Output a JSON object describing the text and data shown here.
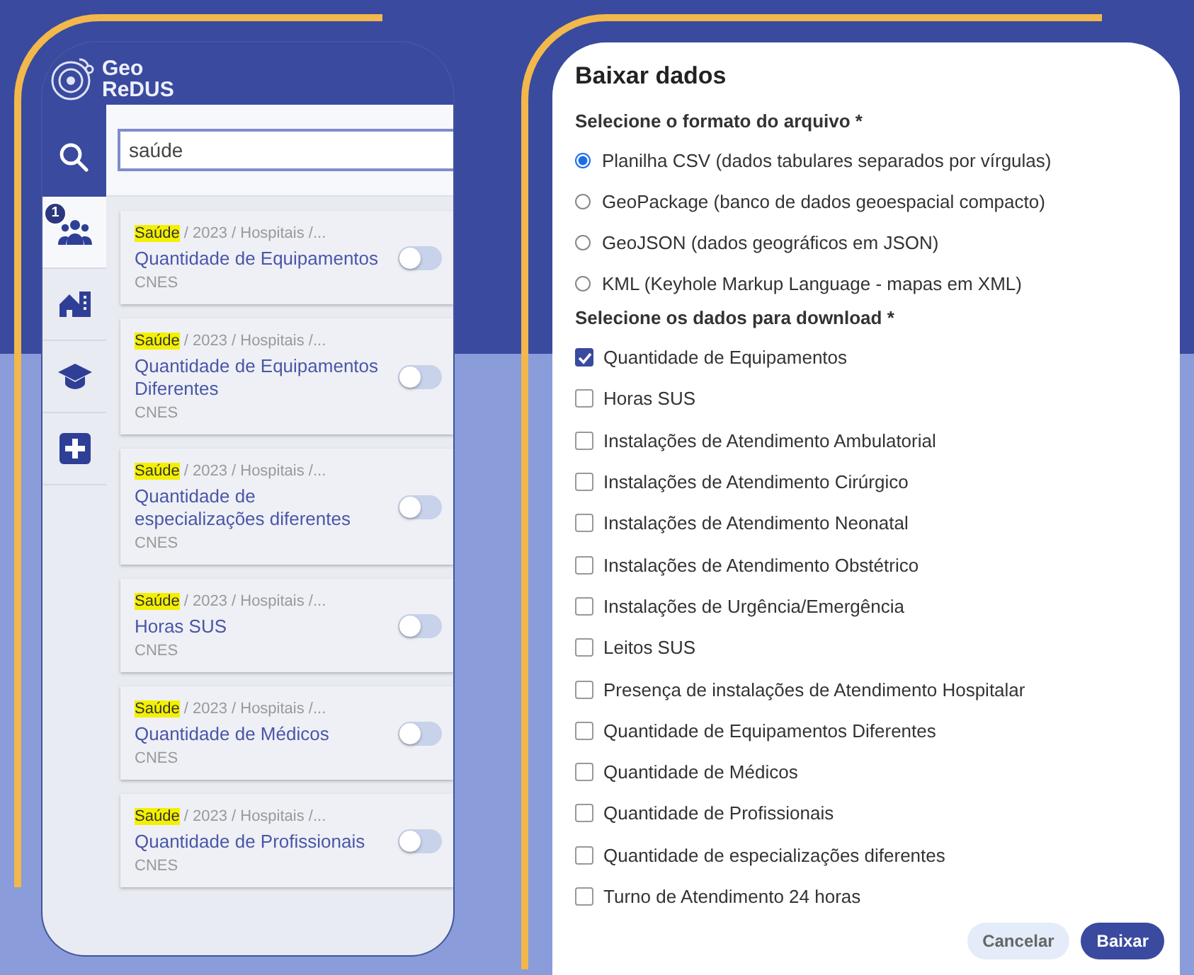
{
  "app": {
    "logo_line_1": "Geo",
    "logo_line_2": "ReDUS"
  },
  "sidebar": {
    "tabs": [
      {
        "kind": "search",
        "selected": false
      },
      {
        "kind": "people",
        "selected": true,
        "badge": "1"
      },
      {
        "kind": "building",
        "selected": false
      },
      {
        "kind": "education",
        "selected": false
      },
      {
        "kind": "health",
        "selected": false
      }
    ]
  },
  "search": {
    "value": "saúde"
  },
  "results": [
    {
      "highlight": "Saúde",
      "path": " / 2023 / Hospitais /...",
      "title": "Quantidade de Equipamentos",
      "source": "CNES",
      "on": false
    },
    {
      "highlight": "Saúde",
      "path": " / 2023 / Hospitais /...",
      "title": "Quantidade de Equipamentos Diferentes",
      "source": "CNES",
      "on": false
    },
    {
      "highlight": "Saúde",
      "path": " / 2023 / Hospitais /...",
      "title": "Quantidade de especializações diferentes",
      "source": "CNES",
      "on": false
    },
    {
      "highlight": "Saúde",
      "path": " / 2023 / Hospitais /...",
      "title": "Horas SUS",
      "source": "CNES",
      "on": false
    },
    {
      "highlight": "Saúde",
      "path": " / 2023 / Hospitais /...",
      "title": "Quantidade de Médicos",
      "source": "CNES",
      "on": false
    },
    {
      "highlight": "Saúde",
      "path": " / 2023 / Hospitais /...",
      "title": "Quantidade de Profissionais",
      "source": "CNES",
      "on": false
    }
  ],
  "dialog": {
    "title": "Baixar dados",
    "format_label": "Selecione o formato do arquivo *",
    "formats": [
      {
        "label": "Planilha CSV (dados tabulares separados por vírgulas)",
        "selected": true
      },
      {
        "label": "GeoPackage (banco de dados geoespacial compacto)",
        "selected": false
      },
      {
        "label": "GeoJSON (dados geográficos em JSON)",
        "selected": false
      },
      {
        "label": "KML (Keyhole Markup Language - mapas em XML)",
        "selected": false
      }
    ],
    "data_label": "Selecione os dados para download *",
    "datasets": [
      {
        "label": "Quantidade de Equipamentos",
        "checked": true
      },
      {
        "label": "Horas SUS",
        "checked": false
      },
      {
        "label": "Instalações de Atendimento Ambulatorial",
        "checked": false
      },
      {
        "label": "Instalações de Atendimento Cirúrgico",
        "checked": false
      },
      {
        "label": "Instalações de Atendimento Neonatal",
        "checked": false
      },
      {
        "label": "Instalações de Atendimento Obstétrico",
        "checked": false
      },
      {
        "label": "Instalações de Urgência/Emergência",
        "checked": false
      },
      {
        "label": "Leitos SUS",
        "checked": false
      },
      {
        "label": "Presença de instalações de Atendimento Hospitalar",
        "checked": false
      },
      {
        "label": "Quantidade de Equipamentos Diferentes",
        "checked": false
      },
      {
        "label": "Quantidade de Médicos",
        "checked": false
      },
      {
        "label": "Quantidade de Profissionais",
        "checked": false
      },
      {
        "label": "Quantidade de especializações diferentes",
        "checked": false
      },
      {
        "label": "Turno de Atendimento 24 horas",
        "checked": false
      }
    ],
    "buttons": [
      {
        "kind": "secondary",
        "label": "Cancelar"
      },
      {
        "kind": "primary",
        "label": "Baixar"
      }
    ]
  }
}
